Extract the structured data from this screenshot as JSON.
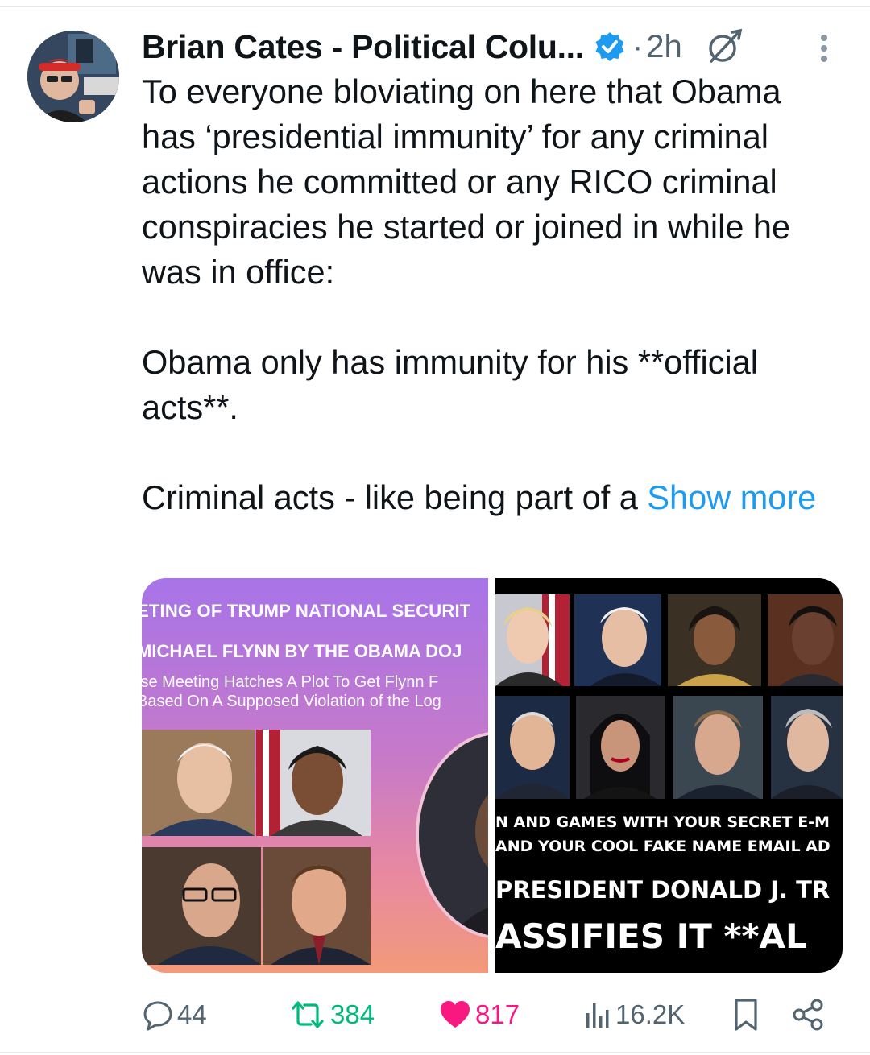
{
  "tweet": {
    "author": "Brian Cates - Political Colu...",
    "separator": "·",
    "time": "2h",
    "paragraphs": [
      "To everyone bloviating on here that Obama has ‘presidential immunity’ for any criminal actions he committed or any RICO criminal conspiracies he started or joined in while he was in office:",
      "Obama only has immunity for his **official acts**.",
      "Criminal acts - like being part of a"
    ],
    "show_more": "Show more"
  },
  "media": {
    "left": {
      "line1": "ETING OF TRUMP NATIONAL SECURIT",
      "line2": "MICHAEL FLYNN BY THE OBAMA DOJ",
      "line3": "ise Meeting Hatches A Plot To Get Flynn F",
      "line4": "Based On A Supposed Violation of the Log"
    },
    "right": {
      "line1": "N AND GAMES WITH YOUR SECRET E-M",
      "line2": "AND YOUR COOL FAKE NAME EMAIL AD",
      "line3": "PRESIDENT DONALD J. TR",
      "line4": "ASSIFIES IT **AL"
    }
  },
  "actions": {
    "replies": "44",
    "reposts": "384",
    "likes": "817",
    "views": "16.2K"
  },
  "colors": {
    "accent": "#1d9bf0",
    "repost": "#00ba7c",
    "like": "#f91880",
    "muted": "#536471"
  }
}
